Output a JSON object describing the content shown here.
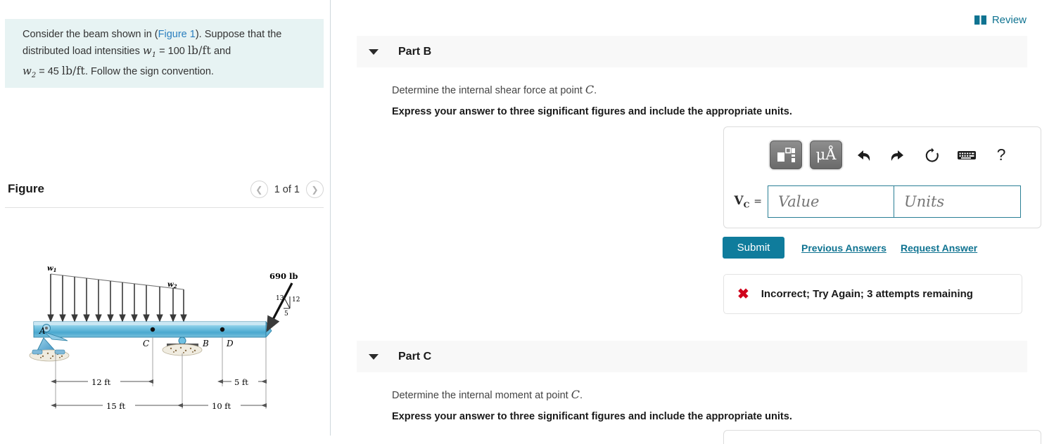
{
  "problem": {
    "line1_pre": "Consider the beam shown in (",
    "figure_link": "Figure 1",
    "line1_post": "). Suppose that the",
    "line2_pre": "distributed load intensities ",
    "w1_symbol": "w",
    "w1_sub": "1",
    "w1_eq": " = 100 ",
    "w1_units": "lb/ft",
    "line2_post": " and",
    "w2_symbol": "w",
    "w2_sub": "2",
    "w2_eq": " = 45 ",
    "w2_units": "lb/ft",
    "line3_post": ". Follow the sign convention."
  },
  "figure": {
    "title": "Figure",
    "counter": "1 of 1",
    "prev_icon": "chevron-left-icon",
    "next_icon": "chevron-right-icon",
    "diagram": {
      "load_label_1": "w",
      "load_label_1_sub": "1",
      "load_label_2": "w",
      "load_label_2_sub": "2",
      "point_force": "690 lb",
      "slope_hyp": "13",
      "slope_vert": "12",
      "slope_horiz": "5",
      "node_a": "A",
      "node_b": "B",
      "node_c": "C",
      "node_d": "D",
      "dim_12ft": "12 ft",
      "dim_5ft": "5 ft",
      "dim_15ft": "15 ft",
      "dim_10ft": "10 ft",
      "beam_color": "#5cb3d9",
      "support_color": "#4a9fd0"
    }
  },
  "header": {
    "review_label": "Review",
    "review_icon": "book-icon",
    "review_color": "#0f7391"
  },
  "parts": [
    {
      "id": "part-b",
      "label": "Part B",
      "caret_icon": "caret-down-icon",
      "prompt_pre": "Determine the internal shear force at point ",
      "prompt_var": "C",
      "prompt_post": ".",
      "instruction": "Express your answer to three significant figures and include the appropriate units.",
      "answer": {
        "variable": "V",
        "variable_sub": "C",
        "equals": "=",
        "value_placeholder": "Value",
        "units_placeholder": "Units",
        "value": "",
        "units": ""
      },
      "toolbar": [
        {
          "name": "template-icon",
          "label": ""
        },
        {
          "name": "units-icon",
          "label": "μÅ"
        },
        {
          "name": "undo-icon",
          "label": "↶"
        },
        {
          "name": "redo-icon",
          "label": "↷"
        },
        {
          "name": "reset-icon",
          "label": "↻"
        },
        {
          "name": "keyboard-icon",
          "label": ""
        },
        {
          "name": "help-icon",
          "label": "?"
        }
      ],
      "submit_label": "Submit",
      "previous_answers_label": "Previous Answers",
      "request_answer_label": "Request Answer",
      "feedback": {
        "icon": "x-mark-icon",
        "text": "Incorrect; Try Again; 3 attempts remaining",
        "color": "#d0021b"
      }
    },
    {
      "id": "part-c",
      "label": "Part C",
      "caret_icon": "caret-down-icon",
      "prompt_pre": "Determine the internal moment at point ",
      "prompt_var": "C",
      "prompt_post": ".",
      "instruction": "Express your answer to three significant figures and include the appropriate units."
    }
  ]
}
